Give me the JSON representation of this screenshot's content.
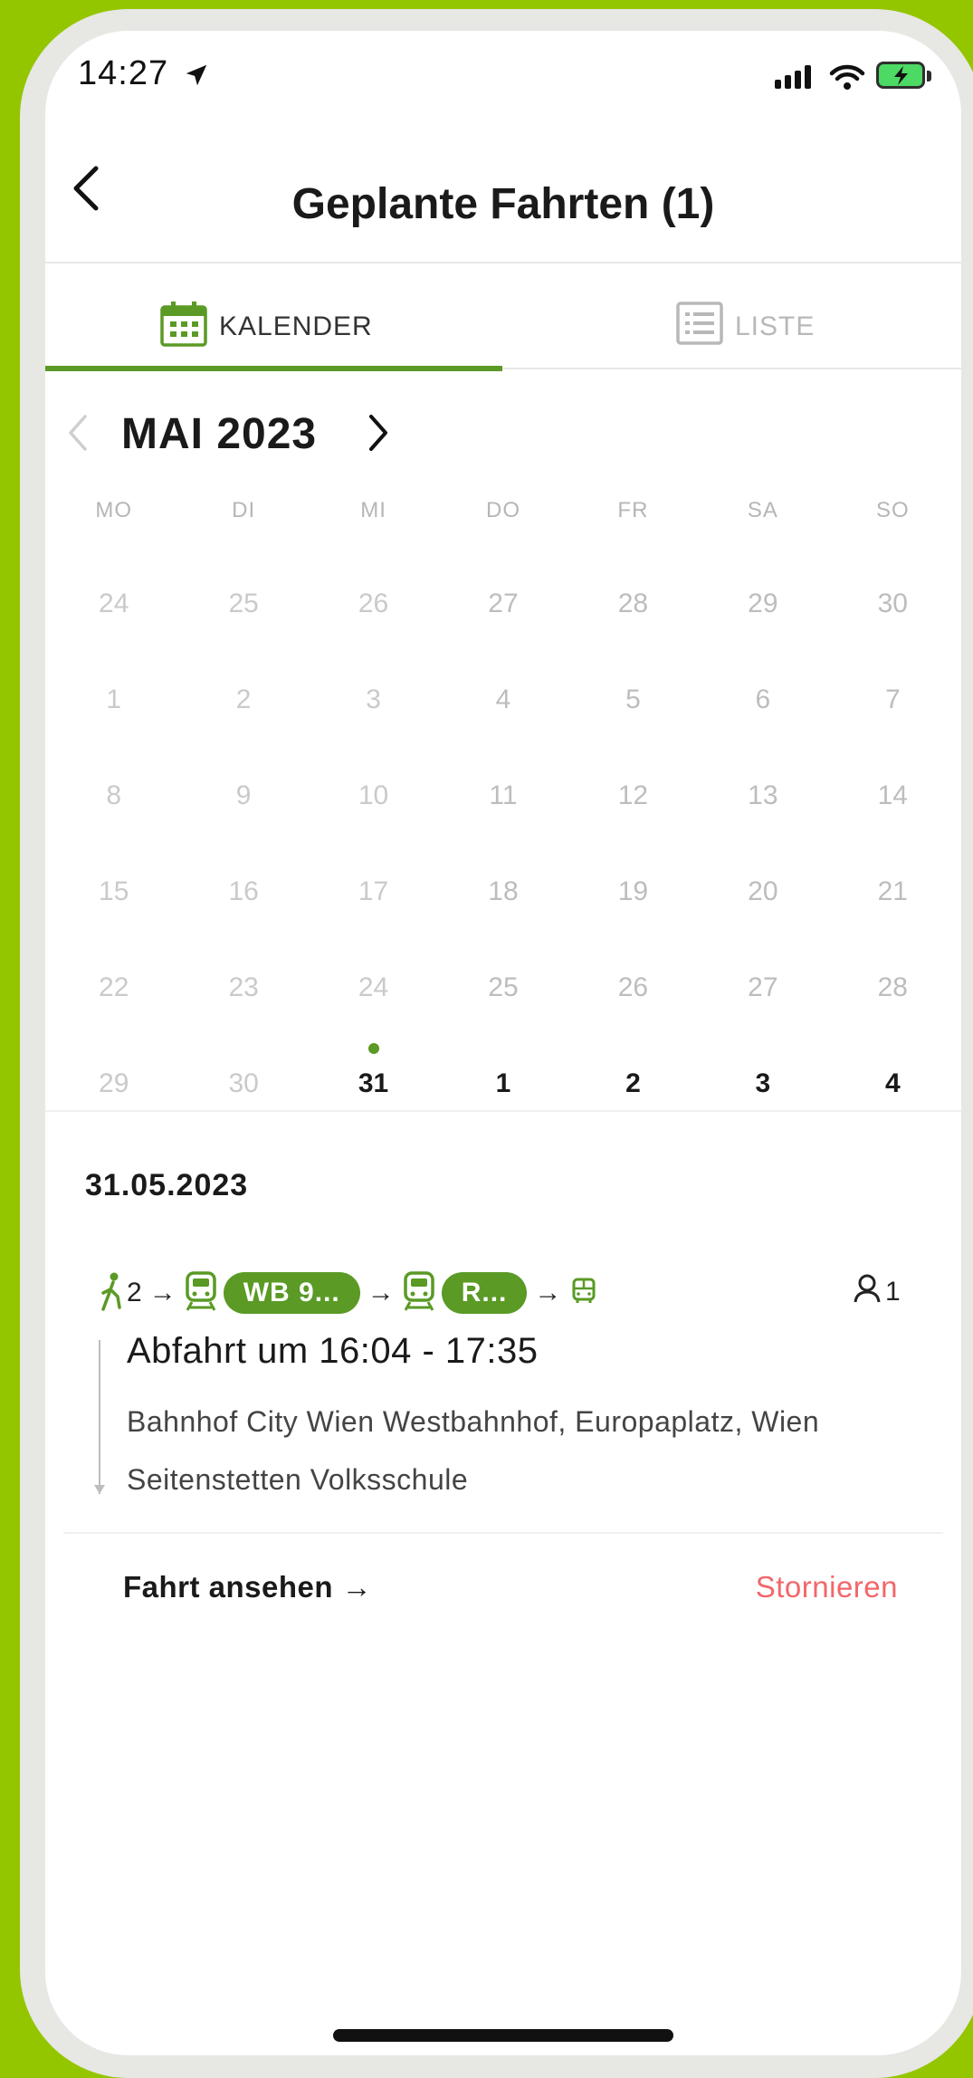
{
  "status_bar": {
    "time": "14:27"
  },
  "nav": {
    "title": "Geplante Fahrten (1)"
  },
  "tabs": [
    {
      "label": "KALENDER",
      "active": true
    },
    {
      "label": "LISTE",
      "active": false
    }
  ],
  "calendar": {
    "month_label": "MAI 2023",
    "weekdays": [
      "MO",
      "DI",
      "MI",
      "DO",
      "FR",
      "SA",
      "SO"
    ],
    "weeks": [
      [
        "24",
        "25",
        "26",
        "27",
        "28",
        "29",
        "30"
      ],
      [
        "1",
        "2",
        "3",
        "4",
        "5",
        "6",
        "7"
      ],
      [
        "8",
        "9",
        "10",
        "11",
        "12",
        "13",
        "14"
      ],
      [
        "15",
        "16",
        "17",
        "18",
        "19",
        "20",
        "21"
      ],
      [
        "22",
        "23",
        "24",
        "25",
        "26",
        "27",
        "28"
      ],
      [
        "29",
        "30",
        "31",
        "1",
        "2",
        "3",
        "4"
      ]
    ]
  },
  "trip": {
    "date": "31.05.2023",
    "walk_minutes": "2",
    "legs": [
      "WB 9...",
      "R..."
    ],
    "passengers": "1",
    "departure": "Abfahrt um 16:04 - 17:35",
    "from": "Bahnhof City Wien Westbahnhof, Europaplatz, Wien",
    "to": "Seitenstetten Volksschule",
    "view_label": "Fahrt ansehen →",
    "cancel_label": "Stornieren"
  },
  "colors": {
    "accent": "#5a9a25",
    "cancel": "#f2676a",
    "background": "#94c600"
  }
}
